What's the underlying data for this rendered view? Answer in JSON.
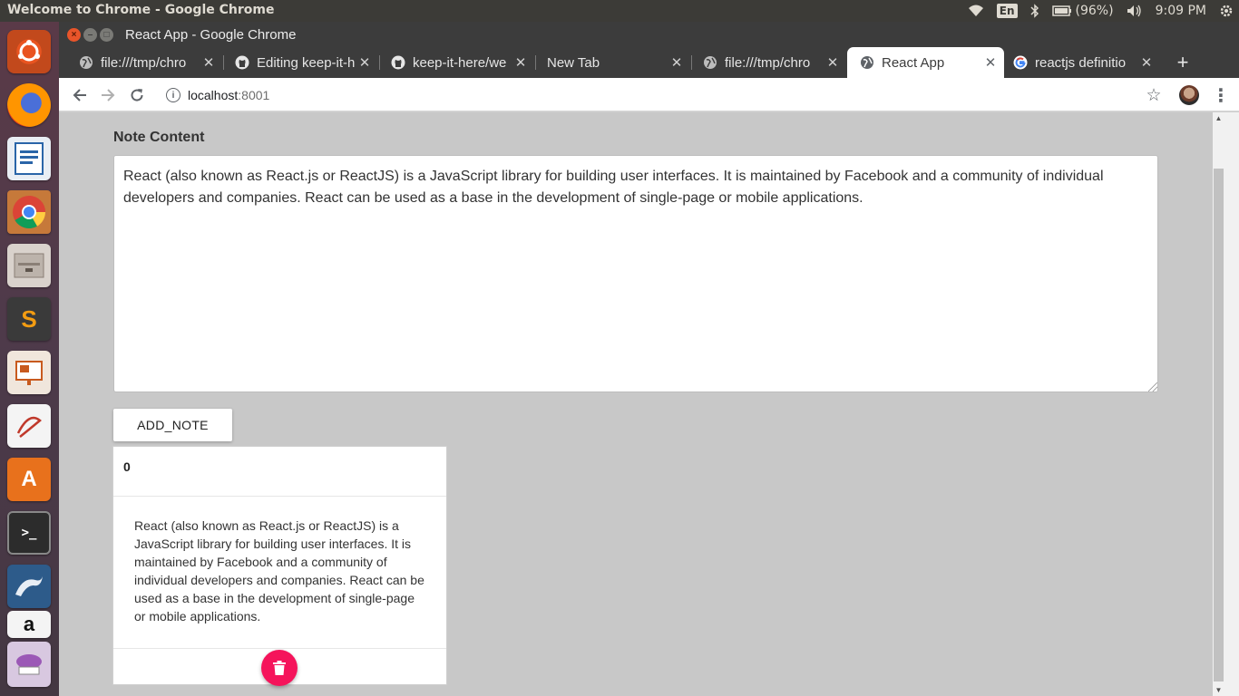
{
  "system": {
    "window_title": "Welcome to Chrome - Google Chrome",
    "keyboard": "En",
    "battery": "(96%)",
    "time": "9:09 PM"
  },
  "launcher": {
    "items": [
      "ubuntu-dash",
      "firefox",
      "libreoffice-writer",
      "chrome",
      "files",
      "sublime-text",
      "libreoffice-impress",
      "document-viewer",
      "software-center",
      "terminal",
      "mysql-workbench",
      "amazon",
      "more-apps"
    ]
  },
  "chrome": {
    "title": "React App - Google Chrome",
    "tabs": [
      {
        "label": "file:///tmp/chro",
        "icon": "globe-icon"
      },
      {
        "label": "Editing keep-it-h",
        "icon": "github-icon"
      },
      {
        "label": "keep-it-here/we",
        "icon": "github-icon"
      },
      {
        "label": "New Tab",
        "icon": ""
      },
      {
        "label": "file:///tmp/chro",
        "icon": "globe-icon"
      },
      {
        "label": "React App",
        "icon": "globe-icon"
      },
      {
        "label": "reactjs definitio",
        "icon": "google-icon"
      }
    ],
    "url_host": "localhost",
    "url_port": ":8001"
  },
  "page": {
    "note_label": "Note Content",
    "note_text": "React (also known as React.js or ReactJS) is a JavaScript library for building user interfaces. It is maintained by Facebook and a community of individual developers and companies. React can be used as a base in the development of single-page or mobile applications.",
    "add_button": "ADD_NOTE",
    "notes": [
      {
        "id": "0",
        "content": "React (also known as React.js or ReactJS) is a JavaScript library for building user interfaces. It is maintained by Facebook and a community of individual developers and companies. React can be used as a base in the development of single-page or mobile applications."
      }
    ]
  },
  "colors": {
    "delete_button": "#f5145b",
    "page_background": "#c8c8c8"
  }
}
